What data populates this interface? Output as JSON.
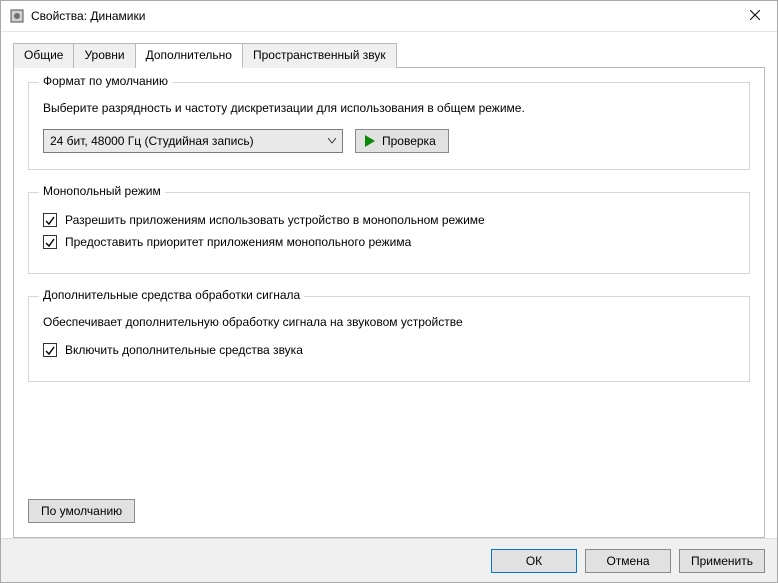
{
  "window": {
    "title": "Свойства: Динамики"
  },
  "tabs": {
    "general": "Общие",
    "levels": "Уровни",
    "advanced": "Дополнительно",
    "spatial": "Пространственный звук"
  },
  "group_format": {
    "legend": "Формат по умолчанию",
    "desc": "Выберите разрядность и частоту дискретизации для использования в общем режиме.",
    "dropdown_value": "24 бит, 48000 Гц (Студийная запись)",
    "test_button": "Проверка"
  },
  "group_exclusive": {
    "legend": "Монопольный режим",
    "allow_exclusive": "Разрешить приложениям использовать устройство в монопольном режиме",
    "give_priority": "Предоставить приоритет приложениям монопольного режима"
  },
  "group_signal": {
    "legend": "Дополнительные средства обработки сигнала",
    "desc": "Обеспечивает дополнительную обработку сигнала на звуковом устройстве",
    "enable_enh": "Включить дополнительные средства звука"
  },
  "defaults_button": "По умолчанию",
  "buttons": {
    "ok": "ОК",
    "cancel": "Отмена",
    "apply": "Применить"
  }
}
